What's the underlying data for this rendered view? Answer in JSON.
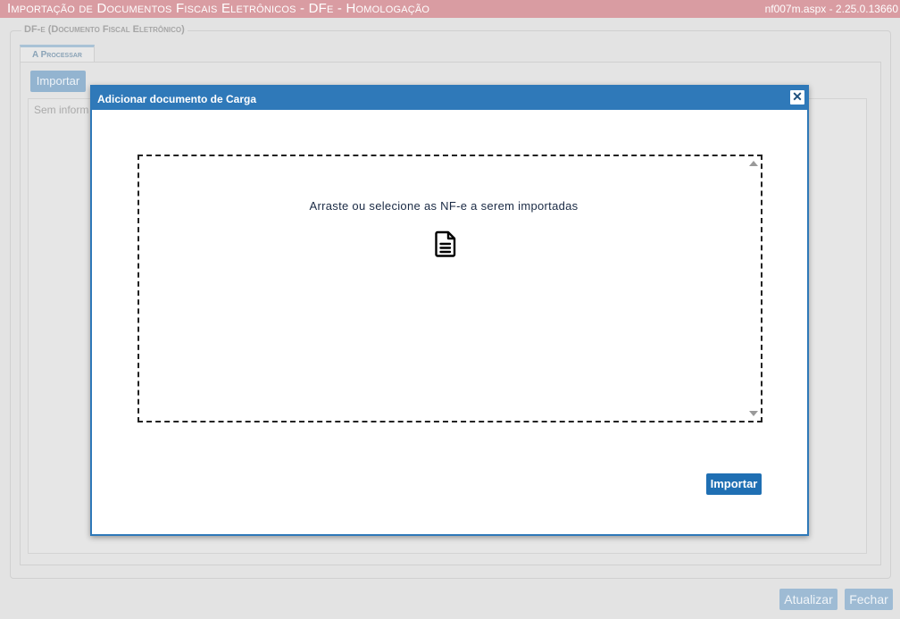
{
  "window": {
    "title": "Importação de Documentos Fiscais Eletrônicos - DFe  - Homologação",
    "version": "nf007m.aspx - 2.25.0.13660"
  },
  "background": {
    "fieldset_legend": "DF-e (Documento Fiscal Eletrônico)",
    "tab_label": "A Processar",
    "import_button": "Importar",
    "empty_grid_text": "Sem informações",
    "footer": {
      "refresh_button": "Atualizar",
      "close_button": "Fechar"
    }
  },
  "modal": {
    "title": "Adicionar documento de Carga",
    "close_icon": "close-icon",
    "dropzone": {
      "text": "Arraste ou selecione as NF-e a serem importadas",
      "icon": "file-text-icon"
    },
    "import_button": "Importar"
  },
  "colors": {
    "titlebar": "#d99ca2",
    "modal_header": "#2f79b9",
    "primary_button": "#1f6fb3"
  }
}
